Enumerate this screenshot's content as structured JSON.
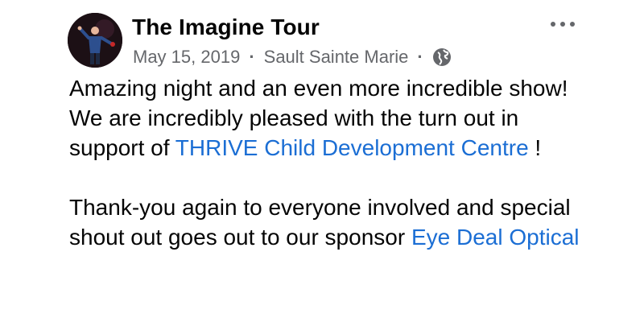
{
  "post": {
    "author": "The Imagine Tour",
    "date": "May 15, 2019",
    "separator": "·",
    "location": "Sault Sainte Marie",
    "privacy_icon": "globe-icon",
    "more_icon": "more-options-icon",
    "paragraph1": {
      "text_before": "Amazing night and an even more incredible show! We are incredibly pleased with the turn out in support of ",
      "link": "THRIVE Child Development Centre",
      "text_after": " !"
    },
    "paragraph2": {
      "text_before": "Thank-you again to everyone involved and special shout out goes out to our sponsor ",
      "link": "Eye Deal Optical"
    }
  },
  "colors": {
    "text": "#050505",
    "secondary_text": "#65676b",
    "link": "#1b6ed4"
  }
}
